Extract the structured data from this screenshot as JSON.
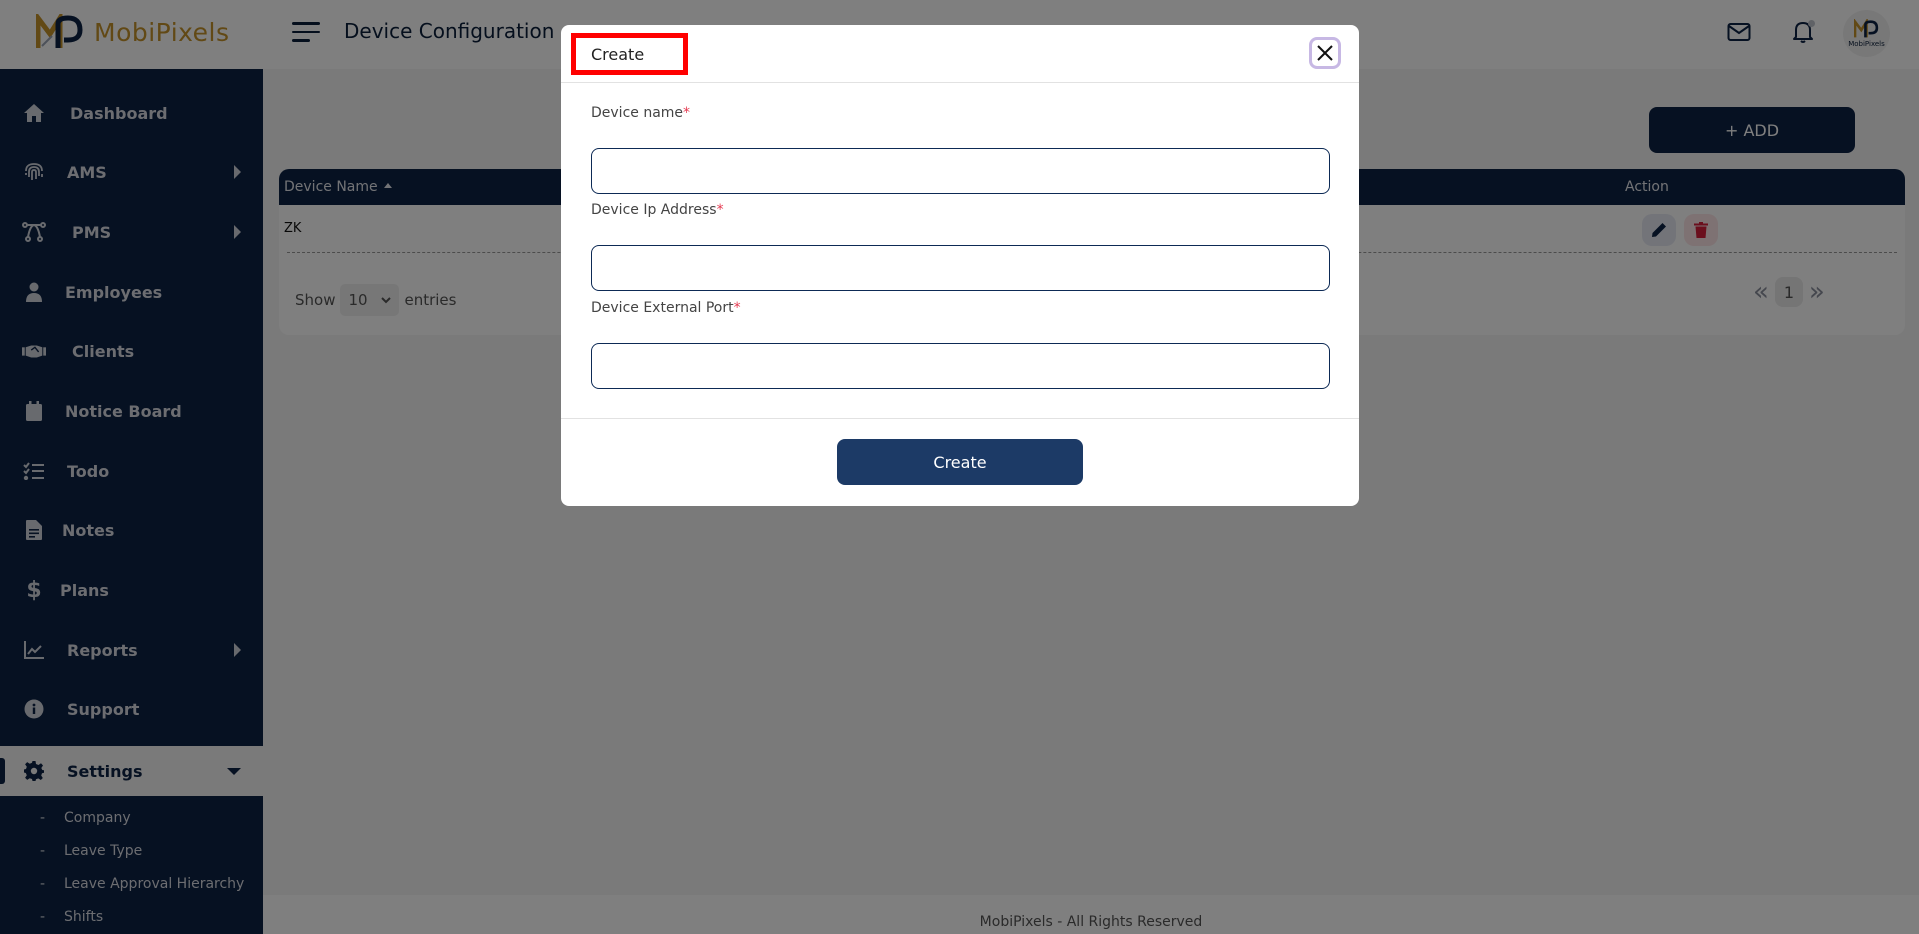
{
  "header": {
    "brand": "MobiPixels",
    "page_title": "Device Configuration",
    "avatar_label": "MobiPixels"
  },
  "sidebar": {
    "items": [
      {
        "label": "Dashboard",
        "icon": "home-icon",
        "has_submenu": false
      },
      {
        "label": "AMS",
        "icon": "fingerprint-icon",
        "has_submenu": true
      },
      {
        "label": "PMS",
        "icon": "bezier-curve-icon",
        "has_submenu": true
      },
      {
        "label": "Employees",
        "icon": "user-icon",
        "has_submenu": false
      },
      {
        "label": "Clients",
        "icon": "handshake-icon",
        "has_submenu": false
      },
      {
        "label": "Notice Board",
        "icon": "calendar-icon",
        "has_submenu": false
      },
      {
        "label": "Todo",
        "icon": "task-list-icon",
        "has_submenu": false
      },
      {
        "label": "Notes",
        "icon": "file-alt-icon",
        "has_submenu": false
      },
      {
        "label": "Plans",
        "icon": "dollar-icon",
        "has_submenu": false
      },
      {
        "label": "Reports",
        "icon": "chart-line-icon",
        "has_submenu": true
      },
      {
        "label": "Support",
        "icon": "info-circle-icon",
        "has_submenu": false
      },
      {
        "label": "Settings",
        "icon": "gear-icon",
        "has_submenu": true,
        "active": true
      }
    ],
    "settings_sub": [
      {
        "label": "Company"
      },
      {
        "label": "Leave Type"
      },
      {
        "label": "Leave Approval Hierarchy"
      },
      {
        "label": "Shifts"
      }
    ]
  },
  "main": {
    "add_button": "+ ADD",
    "table": {
      "columns": [
        "Device Name",
        "Action"
      ],
      "rows": [
        {
          "device_name": "ZK"
        }
      ]
    },
    "show_label": "Show",
    "entries_value": "10",
    "entries_label": "entries",
    "current_page": "1"
  },
  "footer": {
    "text": "MobiPixels - All Rights Reserved"
  },
  "modal": {
    "title": "Create",
    "fields": [
      {
        "label": "Device name",
        "required_mark": "*",
        "value": "",
        "placeholder": ""
      },
      {
        "label": "Device Ip Address",
        "required_mark": "*",
        "value": "",
        "placeholder": ""
      },
      {
        "label": "Device External Port",
        "required_mark": "*",
        "value": "",
        "placeholder": ""
      }
    ],
    "submit_label": "Create"
  },
  "colors": {
    "brand_navy": "#0d2244",
    "brand_gold": "#c5922a",
    "button_navy": "#1c3a66",
    "required_red": "#e53950",
    "highlight_red": "#ff0000",
    "delete_red": "#d61f3a"
  }
}
